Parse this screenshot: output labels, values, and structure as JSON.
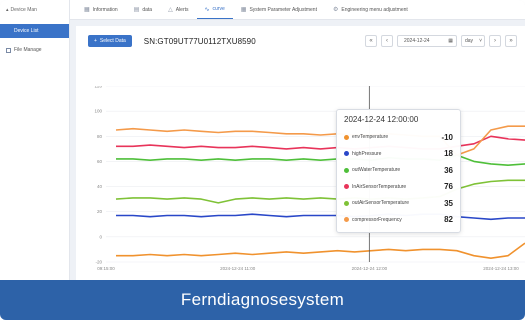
{
  "sidebar": {
    "header": "Device Man",
    "active_item": "Device List",
    "item2": "File Manage"
  },
  "tabs": [
    {
      "label": "Information",
      "icon": "info-icon",
      "active": false
    },
    {
      "label": "data",
      "icon": "data-icon",
      "active": false
    },
    {
      "label": "Alerts",
      "icon": "alert-icon",
      "active": false
    },
    {
      "label": "curve",
      "icon": "curve-icon",
      "active": true
    },
    {
      "label": "System Parameter Adjustment",
      "icon": "grid-icon",
      "active": false
    },
    {
      "label": "Engineering menu adjustment",
      "icon": "gear-icon",
      "active": false
    }
  ],
  "toolbar": {
    "select_label": "Select Data",
    "serial": "SN:GT09UT77U0112TXU8590",
    "date": "2024-12-24",
    "unit": "day"
  },
  "tooltip": {
    "title": "2024-12-24 12:00:00",
    "rows": [
      {
        "name": "envTemperature",
        "value": "-10",
        "color": "#f0922e"
      },
      {
        "name": "highPressure",
        "value": "18",
        "color": "#2947c8"
      },
      {
        "name": "outWaterTemperature",
        "value": "36",
        "color": "#4fbf3a"
      },
      {
        "name": "InAirSensorTemperature",
        "value": "76",
        "color": "#e8345a"
      },
      {
        "name": "outAirSensorTemperature",
        "value": "35",
        "color": "#7fc237"
      },
      {
        "name": "compressorFrequency",
        "value": "82",
        "color": "#f49a4a"
      }
    ]
  },
  "caption": "Ferndiagnosesystem",
  "chart_data": {
    "type": "line",
    "x_ticks": [
      "09:15:00",
      "2024-12-24 11:00",
      "2024-12-24 12:00",
      "2024-12-24 13:00"
    ],
    "y_ticks": [
      -20,
      0,
      20,
      40,
      60,
      80,
      100,
      120
    ],
    "ylim": [
      -20,
      120
    ],
    "cursor_x": "2024-12-24 12:00",
    "series": [
      {
        "name": "envTemperature",
        "color": "#f0922e",
        "y": [
          -15,
          -15,
          -14,
          -15,
          -14,
          -15,
          -14,
          -13,
          -14,
          -13,
          -12,
          -13,
          -12,
          -11,
          -12,
          -11,
          -10,
          -11,
          -10,
          -10,
          -11,
          -15,
          -17,
          -15,
          -5
        ]
      },
      {
        "name": "highPressure",
        "color": "#2947c8",
        "y": [
          17,
          17,
          16,
          17,
          17,
          16,
          17,
          17,
          18,
          17,
          16,
          17,
          17,
          17,
          16,
          17,
          18,
          17,
          18,
          18,
          16,
          15,
          14,
          15,
          15
        ]
      },
      {
        "name": "outWaterTemperature",
        "color": "#4fbf3a",
        "y": [
          62,
          62,
          61,
          62,
          62,
          61,
          62,
          61,
          62,
          62,
          61,
          62,
          61,
          62,
          62,
          61,
          63,
          62,
          62,
          61,
          65,
          60,
          58,
          57,
          58
        ]
      },
      {
        "name": "InAirSensorTemperature",
        "color": "#e8345a",
        "y": [
          72,
          72,
          73,
          72,
          71,
          72,
          71,
          71,
          72,
          71,
          70,
          71,
          70,
          71,
          70,
          71,
          72,
          71,
          70,
          70,
          72,
          74,
          80,
          78,
          77
        ]
      },
      {
        "name": "outAirSensorTemperature",
        "color": "#7fc237",
        "y": [
          30,
          31,
          31,
          30,
          31,
          30,
          27,
          30,
          31,
          30,
          31,
          30,
          31,
          30,
          31,
          30,
          31,
          30,
          31,
          32,
          38,
          42,
          44,
          45,
          45
        ]
      },
      {
        "name": "compressorFrequency",
        "color": "#f49a4a",
        "y": [
          85,
          86,
          85,
          84,
          85,
          84,
          83,
          84,
          84,
          83,
          82,
          82,
          81,
          82,
          81,
          81,
          82,
          81,
          80,
          80,
          65,
          70,
          85,
          88,
          88
        ]
      }
    ]
  }
}
